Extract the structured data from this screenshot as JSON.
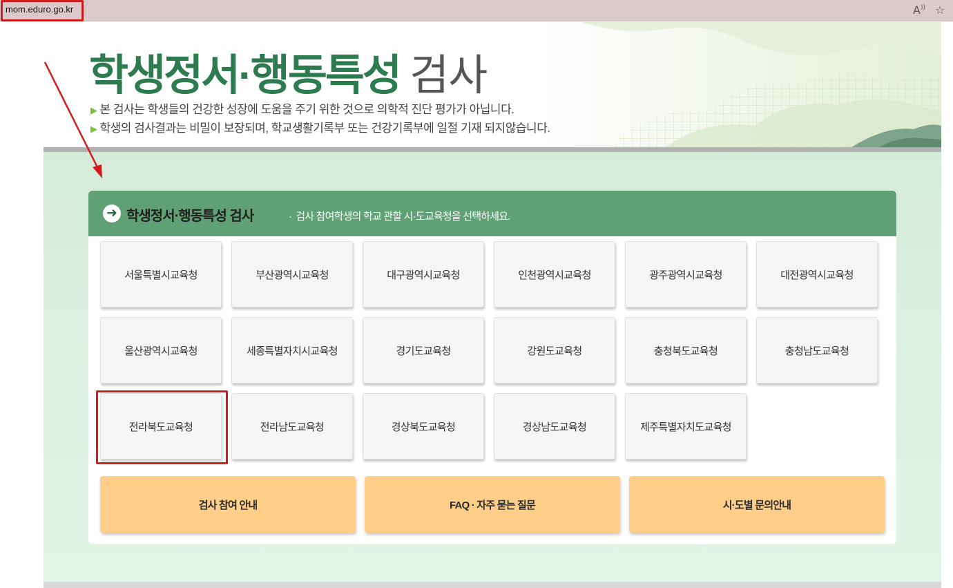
{
  "browser": {
    "url": "mom.eduro.go.kr",
    "icons": [
      "read-aloud-icon",
      "favorite-star-icon"
    ]
  },
  "hero": {
    "title_bold": "학생정서·행동특성",
    "title_light": "검사",
    "notices": [
      "본 검사는 학생들의 건강한 성장에 도움을 주기 위한 것으로 의학적 진단 평가가 아닙니다.",
      "학생의 검사결과는 비밀이 보장되며, 학교생활기록부 또는 건강기록부에 일절 기재 되지않습니다."
    ]
  },
  "panel": {
    "title": "학생정서·행동특성 검사",
    "subtitle": "검사 참여학생의 학교 관할 시·도교육청을 선택하세요.",
    "offices": [
      "서울특별시교육청",
      "부산광역시교육청",
      "대구광역시교육청",
      "인천광역시교육청",
      "광주광역시교육청",
      "대전광역시교육청",
      "울산광역시교육청",
      "세종특별자치시교육청",
      "경기도교육청",
      "강원도교육청",
      "충청북도교육청",
      "충청남도교육청",
      "전라북도교육청",
      "전라남도교육청",
      "경상북도교육청",
      "경상남도교육청",
      "제주특별자치도교육청"
    ],
    "highlighted_office": "전라북도교육청",
    "info_buttons": [
      "검사 참여 안내",
      "FAQ · 자주 묻는 질문",
      "시·도별 문의안내"
    ]
  },
  "colors": {
    "title_green": "#2e7b50",
    "header_green": "#5fa074",
    "info_button": "#ffce89",
    "annotation_red": "#d21c1c"
  }
}
